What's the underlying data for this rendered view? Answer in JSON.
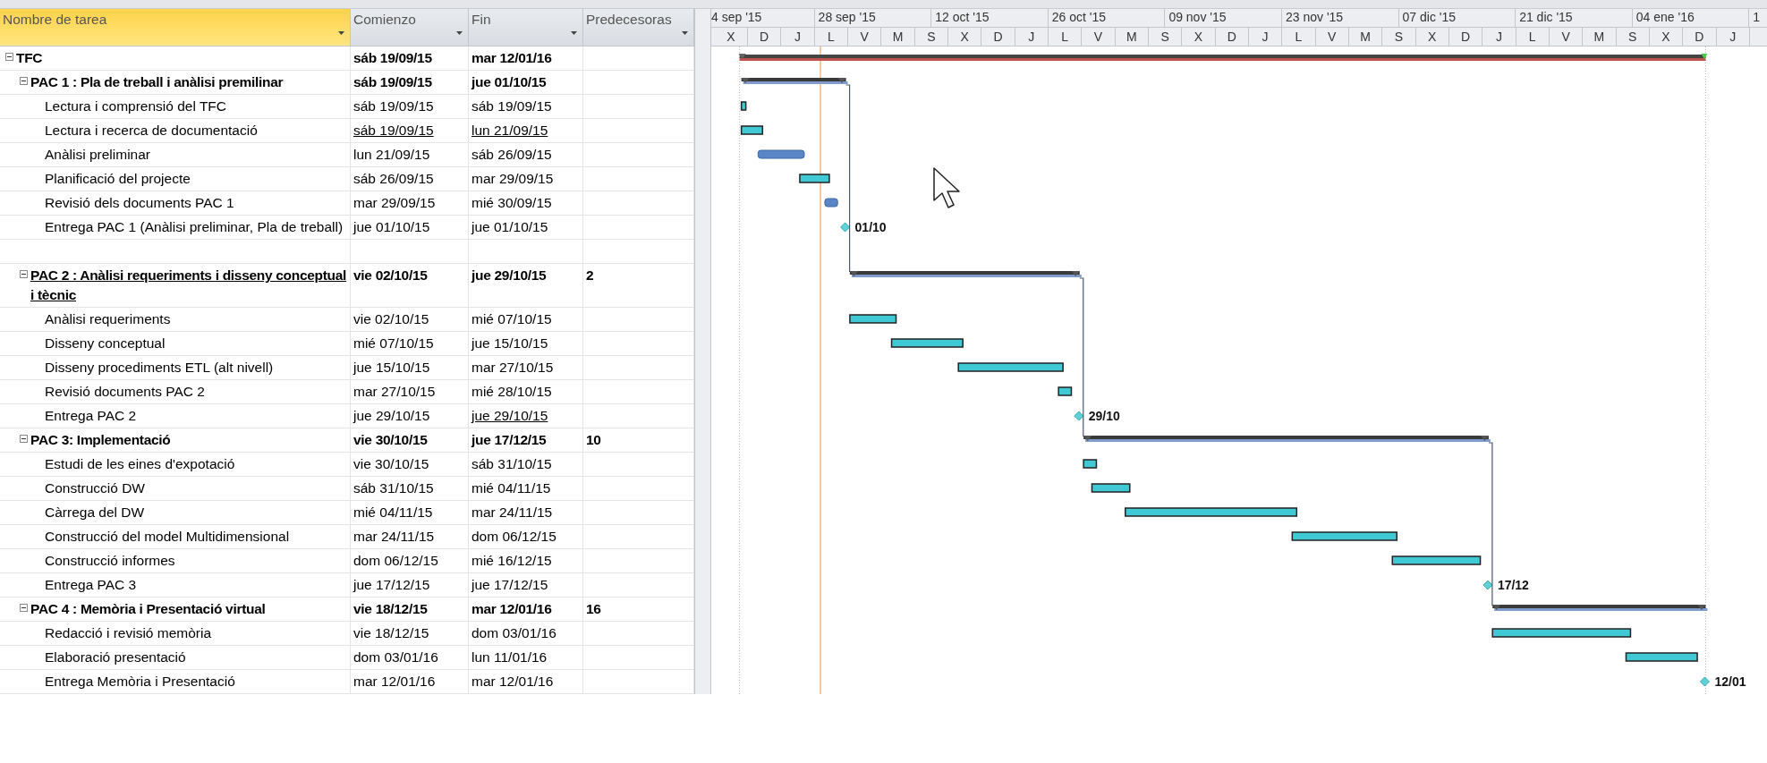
{
  "table": {
    "columns": [
      {
        "label": "Nombre de tarea",
        "selected": true
      },
      {
        "label": "Comienzo",
        "selected": false
      },
      {
        "label": "Fin",
        "selected": false
      },
      {
        "label": "Predecesoras",
        "selected": false
      }
    ]
  },
  "timescale": {
    "major": [
      "4 sep '15",
      "28 sep '15",
      "12 oct '15",
      "26 oct '15",
      "09 nov '15",
      "23 nov '15",
      "07 dic '15",
      "21 dic '15",
      "04 ene '16",
      "1"
    ],
    "minor": [
      "X",
      "D",
      "J",
      "L",
      "V",
      "M",
      "S",
      "X",
      "D",
      "J",
      "L",
      "V",
      "M",
      "S",
      "X",
      "D",
      "J",
      "L",
      "V",
      "M",
      "S",
      "X",
      "D",
      "J",
      "L",
      "V",
      "M",
      "S",
      "X",
      "D",
      "J"
    ]
  },
  "tasks": [
    {
      "name": "TFC",
      "kind": "project",
      "expanded": true,
      "start": "sáb 19/09/15",
      "finish": "mar 12/01/16",
      "name_underlined": false,
      "start_underlined": false,
      "finish_underlined": false,
      "children": [
        {
          "name": "PAC 1 : Pla de treball i anàlisi premilinar",
          "kind": "summary",
          "expanded": true,
          "start": "sáb 19/09/15",
          "finish": "jue 01/10/15",
          "name_underlined": false,
          "start_underlined": false,
          "finish_underlined": false,
          "children": [
            {
              "name": "Lectura i comprensió del TFC",
              "kind": "manual",
              "start": "sáb 19/09/15",
              "finish": "sáb 19/09/15",
              "name_underlined": false,
              "start_underlined": false,
              "finish_underlined": false
            },
            {
              "name": "Lectura i recerca de documentació",
              "kind": "manual",
              "start": "sáb 19/09/15",
              "finish": "lun 21/09/15",
              "name_underlined": false,
              "start_underlined": true,
              "finish_underlined": true
            },
            {
              "name": "Anàlisi preliminar",
              "kind": "auto",
              "start": "lun 21/09/15",
              "finish": "sáb 26/09/15",
              "name_underlined": false,
              "start_underlined": false,
              "finish_underlined": false
            },
            {
              "name": "Planificació del projecte",
              "kind": "manual",
              "start": "sáb 26/09/15",
              "finish": "mar 29/09/15",
              "name_underlined": false,
              "start_underlined": false,
              "finish_underlined": false
            },
            {
              "name": "Revisió dels documents PAC 1",
              "kind": "auto",
              "start": "mar 29/09/15",
              "finish": "mié 30/09/15",
              "name_underlined": false,
              "start_underlined": false,
              "finish_underlined": false
            },
            {
              "name": "Entrega PAC 1 (Anàlisi preliminar, Pla de treball)",
              "kind": "milestone",
              "start": "jue 01/10/15",
              "finish": "jue 01/10/15",
              "label": "01/10",
              "name_underlined": false,
              "start_underlined": false,
              "finish_underlined": false
            }
          ]
        },
        {
          "kind": "blank"
        },
        {
          "name": "PAC 2 :  Anàlisi requeriments i disseny conceptual i tècnic",
          "kind": "summary",
          "expanded": true,
          "start": "vie 02/10/15",
          "finish": "jue 29/10/15",
          "predecessors": "2",
          "name_underlined": true,
          "start_underlined": false,
          "finish_underlined": false,
          "children": [
            {
              "name": "Anàlisi requeriments",
              "kind": "manual",
              "start": "vie 02/10/15",
              "finish": "mié 07/10/15",
              "name_underlined": false,
              "start_underlined": false,
              "finish_underlined": false
            },
            {
              "name": "Disseny conceptual",
              "kind": "manual",
              "start": "mié 07/10/15",
              "finish": "jue 15/10/15",
              "name_underlined": false,
              "start_underlined": false,
              "finish_underlined": false
            },
            {
              "name": "Disseny procediments ETL (alt nivell)",
              "kind": "manual",
              "start": "jue 15/10/15",
              "finish": "mar 27/10/15",
              "name_underlined": false,
              "start_underlined": false,
              "finish_underlined": false
            },
            {
              "name": "Revisió documents PAC 2",
              "kind": "manual",
              "start": "mar 27/10/15",
              "finish": "mié 28/10/15",
              "name_underlined": false,
              "start_underlined": false,
              "finish_underlined": false
            },
            {
              "name": "Entrega PAC 2",
              "kind": "milestone",
              "start": "jue 29/10/15",
              "finish": "jue 29/10/15",
              "label": "29/10",
              "name_underlined": false,
              "start_underlined": false,
              "finish_underlined": true
            }
          ]
        },
        {
          "name": "PAC 3: Implementació",
          "kind": "summary",
          "expanded": true,
          "start": "vie 30/10/15",
          "finish": "jue 17/12/15",
          "predecessors": "10",
          "name_underlined": false,
          "start_underlined": false,
          "finish_underlined": false,
          "children": [
            {
              "name": "Estudi de les eines d'expotació",
              "kind": "manual",
              "start": "vie 30/10/15",
              "finish": "sáb 31/10/15",
              "name_underlined": false,
              "start_underlined": false,
              "finish_underlined": false
            },
            {
              "name": "Construcció DW",
              "kind": "manual",
              "start": "sáb 31/10/15",
              "finish": "mié 04/11/15",
              "name_underlined": false,
              "start_underlined": false,
              "finish_underlined": false
            },
            {
              "name": "Càrrega del DW",
              "kind": "manual",
              "start": "mié 04/11/15",
              "finish": "mar 24/11/15",
              "name_underlined": false,
              "start_underlined": false,
              "finish_underlined": false
            },
            {
              "name": "Construcció del model Multidimensional",
              "kind": "manual",
              "start": "mar 24/11/15",
              "finish": "dom 06/12/15",
              "name_underlined": false,
              "start_underlined": false,
              "finish_underlined": false
            },
            {
              "name": "Construcció informes",
              "kind": "manual",
              "start": "dom 06/12/15",
              "finish": "mié 16/12/15",
              "name_underlined": false,
              "start_underlined": false,
              "finish_underlined": false
            },
            {
              "name": "Entrega PAC 3",
              "kind": "milestone",
              "start": "jue 17/12/15",
              "finish": "jue 17/12/15",
              "label": "17/12",
              "name_underlined": false,
              "start_underlined": false,
              "finish_underlined": false
            }
          ]
        },
        {
          "name": "PAC 4 : Memòria i Presentació virtual",
          "kind": "summary",
          "expanded": true,
          "start": "vie 18/12/15",
          "finish": "mar 12/01/16",
          "predecessors": "16",
          "name_underlined": false,
          "start_underlined": false,
          "finish_underlined": false,
          "children": [
            {
              "name": "Redacció i revisió memòria",
              "kind": "manual",
              "start": "vie 18/12/15",
              "finish": "dom 03/01/16",
              "name_underlined": false,
              "start_underlined": false,
              "finish_underlined": false
            },
            {
              "name": "Elaboració presentació",
              "kind": "manual",
              "start": "dom 03/01/16",
              "finish": "lun 11/01/16",
              "name_underlined": false,
              "start_underlined": false,
              "finish_underlined": false
            },
            {
              "name": "Entrega Memòria i Presentació",
              "kind": "milestone",
              "start": "mar 12/01/16",
              "finish": "mar 12/01/16",
              "label": "12/01",
              "name_underlined": false,
              "start_underlined": false,
              "finish_underlined": false
            }
          ]
        }
      ]
    }
  ]
}
